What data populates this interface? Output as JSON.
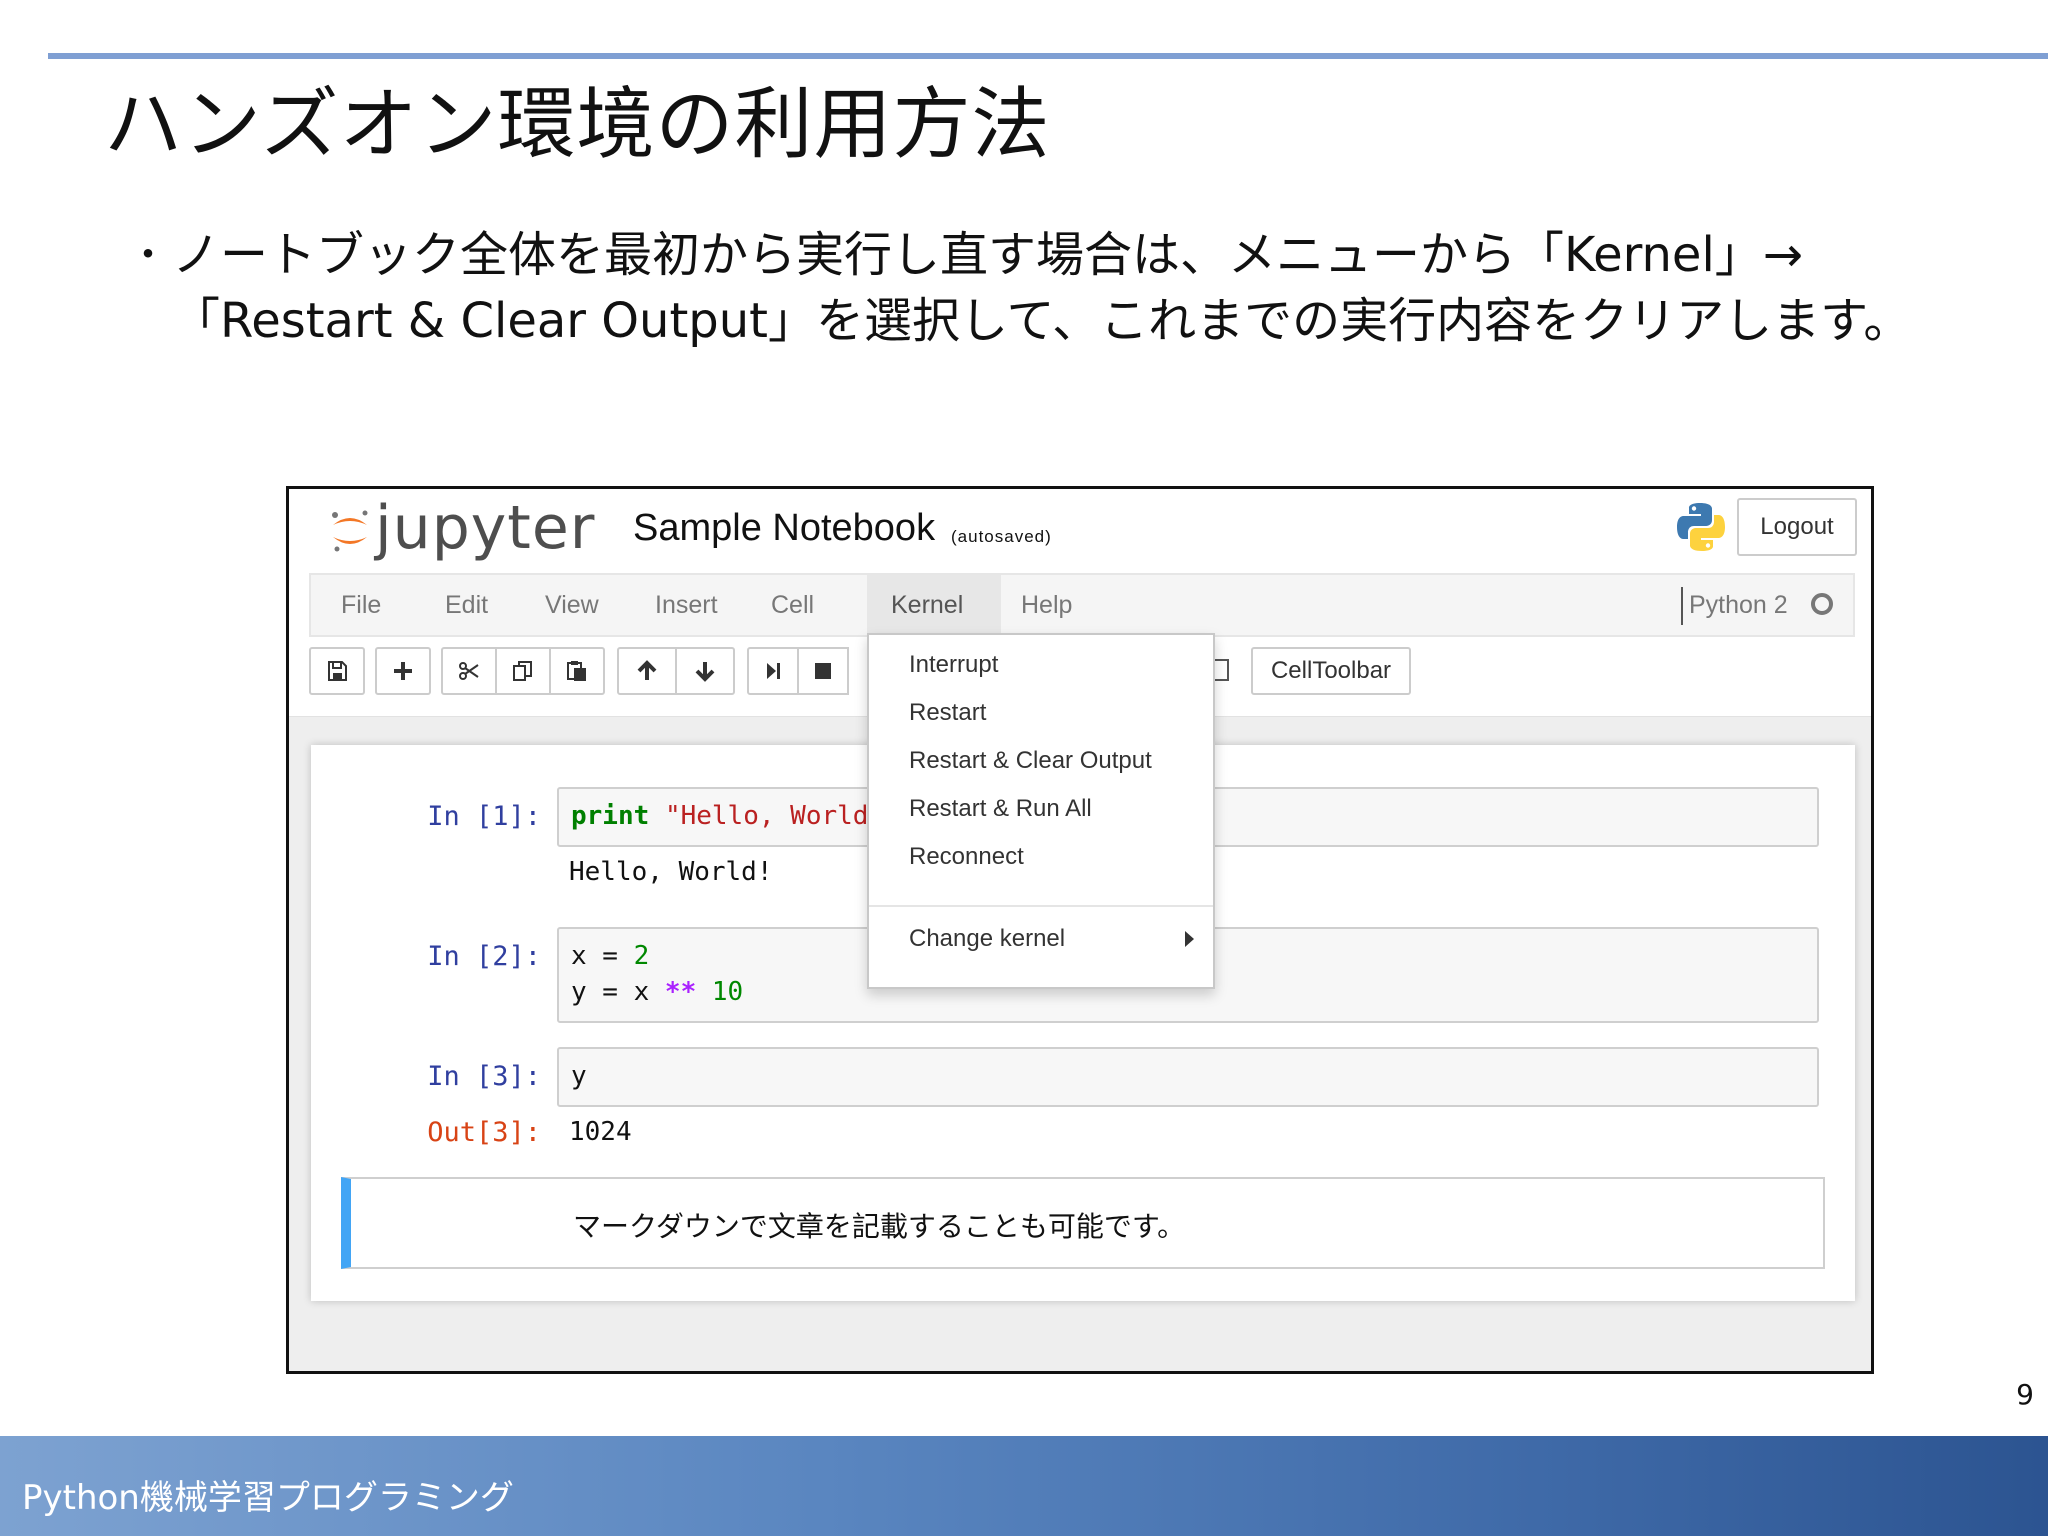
{
  "slide": {
    "title": "ハンズオン環境の利用方法",
    "bullet_mark": "・",
    "bullet": "ノートブック全体を最初から実行し直す場合は、メニューから「Kernel」→「Restart & Clear Output」を選択して、これまでの実行内容をクリアします。",
    "page_number": "9",
    "footer": "Python機械学習プログラミング"
  },
  "colors": {
    "title_rule": "#7f9fd3",
    "footer_start": "#7da2d1",
    "footer_end": "#2c5491",
    "jupyter_orange": "#f37726",
    "prompt_in": "#303f9f",
    "prompt_out": "#d84315",
    "markdown_accent": "#42a5f5"
  },
  "jupyter": {
    "logo_text": "jupyter",
    "notebook_title": "Sample Notebook",
    "autosave_status": "(autosaved)",
    "logout_label": "Logout",
    "menu": [
      "File",
      "Edit",
      "View",
      "Insert",
      "Cell",
      "Kernel",
      "Help"
    ],
    "active_menu": "Kernel",
    "kernel_name": "Python 2",
    "kernel_status_icon": "circle-outline",
    "toolbar": {
      "icons": [
        "save-icon",
        "plus-icon",
        "scissors-icon",
        "copy-icon",
        "paste-icon",
        "arrow-up-icon",
        "arrow-down-icon",
        "step-forward-icon",
        "stop-icon"
      ],
      "celltoolbar_label": "CellToolbar"
    },
    "kernel_menu": {
      "items": [
        "Interrupt",
        "Restart",
        "Restart & Clear Output",
        "Restart & Run All",
        "Reconnect"
      ],
      "submenu_item": "Change kernel"
    },
    "cells": [
      {
        "prompt": "In [1]:",
        "code": [
          {
            "kw": "print",
            "str": "\"Hello, World!\""
          }
        ],
        "output": "Hello, World!"
      },
      {
        "prompt": "In [2]:",
        "lines": [
          {
            "var": "x",
            "eq": " = ",
            "num": "2"
          },
          {
            "var": "y",
            "eq": " = ",
            "expr": "x",
            "op": " ** ",
            "num": "10"
          }
        ]
      },
      {
        "prompt": "In [3]:",
        "code_text": "y",
        "out_prompt": "Out[3]:",
        "output": "1024"
      }
    ],
    "markdown_text": "マークダウンで文章を記載することも可能です。"
  }
}
